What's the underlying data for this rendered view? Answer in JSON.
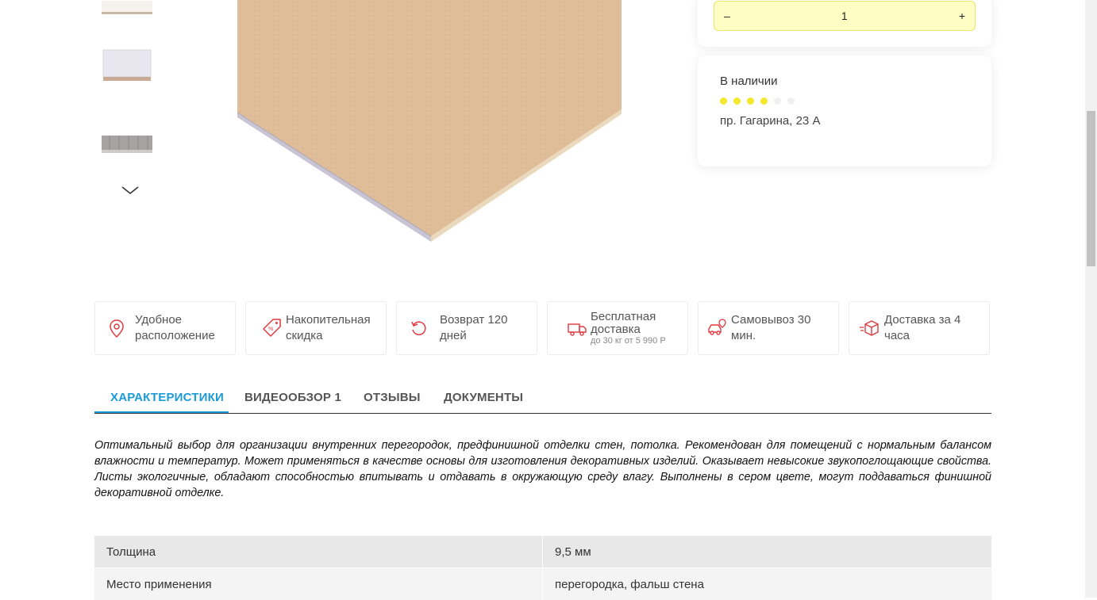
{
  "quantity": {
    "minus": "–",
    "value": "1",
    "plus": "+"
  },
  "stock": {
    "status": "В наличии",
    "rating_filled": 4,
    "rating_total": 6,
    "address": "пр. Гагарина, 23 А"
  },
  "features": [
    {
      "icon": "location-pin-icon",
      "label": "Удобное расположение"
    },
    {
      "icon": "discount-tag-icon",
      "label": "Накопительная скидка"
    },
    {
      "icon": "return-arrow-icon",
      "label": "Возврат 120 дней"
    },
    {
      "icon": "delivery-truck-icon",
      "label": "Бесплатная доставка",
      "sub": "до 30 кг от 5 990 Р"
    },
    {
      "icon": "car-pickup-icon",
      "label": "Самовывоз 30 мин."
    },
    {
      "icon": "box-delivery-icon",
      "label": "Доставка за 4 часа"
    }
  ],
  "tabs": [
    "ХАРАКТЕРИСТИКИ",
    "ВИДЕООБЗОР 1",
    "ОТЗЫВЫ",
    "ДОКУМЕНТЫ"
  ],
  "description": "Оптимальный выбор для организации внутренних перегородок, предфинишной отделки стен, потолка. Рекомендован для помещений с нормальным балансом влажности и температур. Может применяться в качестве основы для изготовления декоративных изделий. Оказывает невысокие звукопоглощающие свойства. Листы экологичные, обладают способностью впитывать и отдавать в окружающую среду влагу. Выполнены в сером цвете, могут поддаваться финишной декоративной отделке.",
  "specs": [
    {
      "name": "Толщина",
      "value": "9,5 мм"
    },
    {
      "name": "Место применения",
      "value": "перегородка, фальш стена"
    }
  ],
  "colors": {
    "accent": "#1a9bd7",
    "icon_red": "#e0393e",
    "qty_bg": "#fdfdc4",
    "star": "#f5e72b"
  }
}
